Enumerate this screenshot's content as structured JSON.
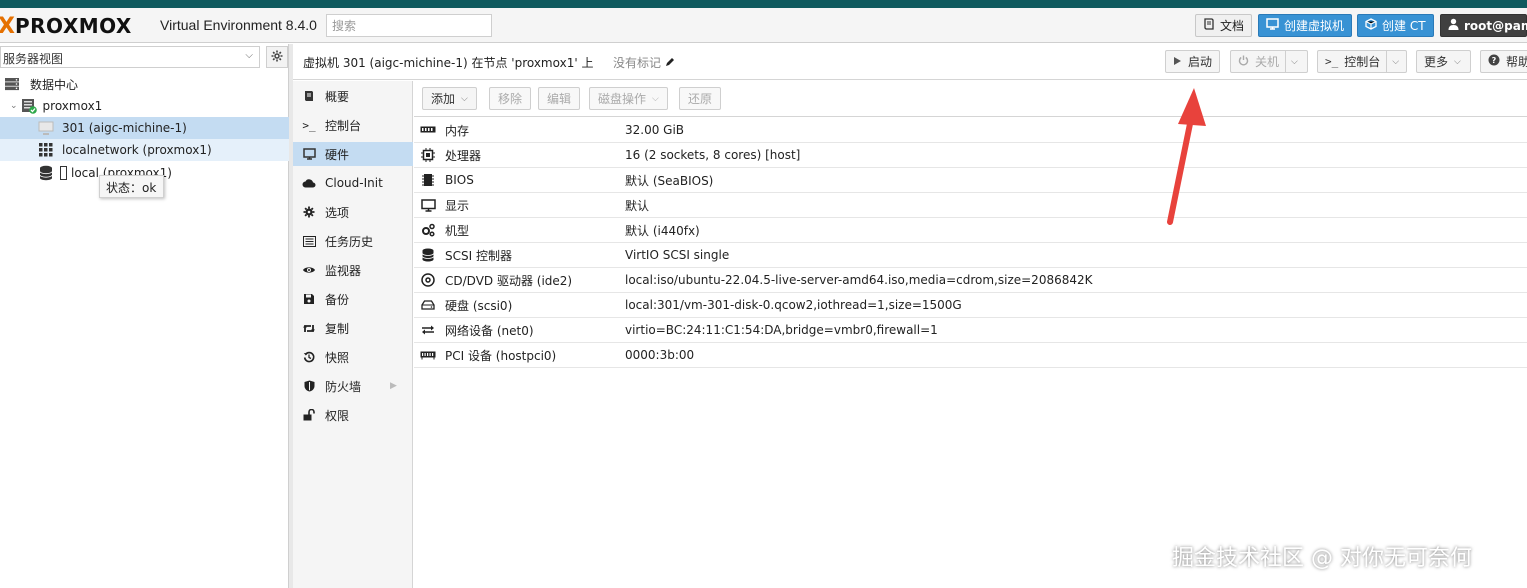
{
  "header": {
    "brand": "PROXMOX",
    "version": "Virtual Environment 8.4.0",
    "search_placeholder": "搜索",
    "docs_label": "文档",
    "create_vm_label": "创建虚拟机",
    "create_ct_label": "创建 CT",
    "user_label": "root@pam"
  },
  "tree": {
    "view_label": "服务器视图",
    "items": [
      {
        "label": "数据中心"
      },
      {
        "label": "proxmox1"
      },
      {
        "label": "301 (aigc-michine-1)"
      },
      {
        "label": "localnetwork (proxmox1)"
      },
      {
        "label": "local (proxmox1)"
      }
    ],
    "tooltip": "状态：ok"
  },
  "content_header": {
    "title": "虚拟机 301 (aigc-michine-1) 在节点 'proxmox1' 上",
    "tags": "没有标记",
    "start_label": "启动",
    "shutdown_label": "关机",
    "console_label": "控制台",
    "more_label": "更多",
    "help_label": "帮助"
  },
  "nav": {
    "items": [
      {
        "label": "概要",
        "icon": "book-icon"
      },
      {
        "label": "控制台",
        "icon": "terminal-icon"
      },
      {
        "label": "硬件",
        "icon": "monitor-icon"
      },
      {
        "label": "Cloud-Init",
        "icon": "cloud-icon"
      },
      {
        "label": "选项",
        "icon": "gear-icon"
      },
      {
        "label": "任务历史",
        "icon": "list-icon"
      },
      {
        "label": "监视器",
        "icon": "eye-icon"
      },
      {
        "label": "备份",
        "icon": "floppy-icon"
      },
      {
        "label": "复制",
        "icon": "retweet-icon"
      },
      {
        "label": "快照",
        "icon": "history-icon"
      },
      {
        "label": "防火墙",
        "icon": "shield-icon"
      },
      {
        "label": "权限",
        "icon": "unlock-icon"
      }
    ],
    "selected": "硬件"
  },
  "hardware_toolbar": {
    "add": "添加",
    "remove": "移除",
    "edit": "编辑",
    "disk_action": "磁盘操作",
    "revert": "还原"
  },
  "hardware": [
    {
      "name": "内存",
      "value": "32.00 GiB",
      "icon": "memory-icon"
    },
    {
      "name": "处理器",
      "value": "16 (2 sockets, 8 cores) [host]",
      "icon": "cpu-icon"
    },
    {
      "name": "BIOS",
      "value": "默认 (SeaBIOS)",
      "icon": "microchip-icon"
    },
    {
      "name": "显示",
      "value": "默认",
      "icon": "display-icon"
    },
    {
      "name": "机型",
      "value": "默认 (i440fx)",
      "icon": "cogs-icon"
    },
    {
      "name": "SCSI 控制器",
      "value": "VirtIO SCSI single",
      "icon": "database-icon"
    },
    {
      "name": "CD/DVD 驱动器 (ide2)",
      "value": "local:iso/ubuntu-22.04.5-live-server-amd64.iso,media=cdrom,size=2086842K",
      "icon": "cdrom-icon"
    },
    {
      "name": "硬盘 (scsi0)",
      "value": "local:301/vm-301-disk-0.qcow2,iothread=1,size=1500G",
      "icon": "hdd-icon"
    },
    {
      "name": "网络设备 (net0)",
      "value": "virtio=BC:24:11:C1:54:DA,bridge=vmbr0,firewall=1",
      "icon": "exchange-icon"
    },
    {
      "name": "PCI 设备 (hostpci0)",
      "value": "0000:3b:00",
      "icon": "pci-icon"
    }
  ],
  "watermark": "掘金技术社区 @ 对你无可奈何",
  "colors": {
    "brand_orange": "#e57000",
    "top_stripe": "#0f5a5e",
    "selected_row": "#c4dcf2",
    "primary_button": "#3892d4",
    "annotation_arrow": "#e8423c"
  }
}
